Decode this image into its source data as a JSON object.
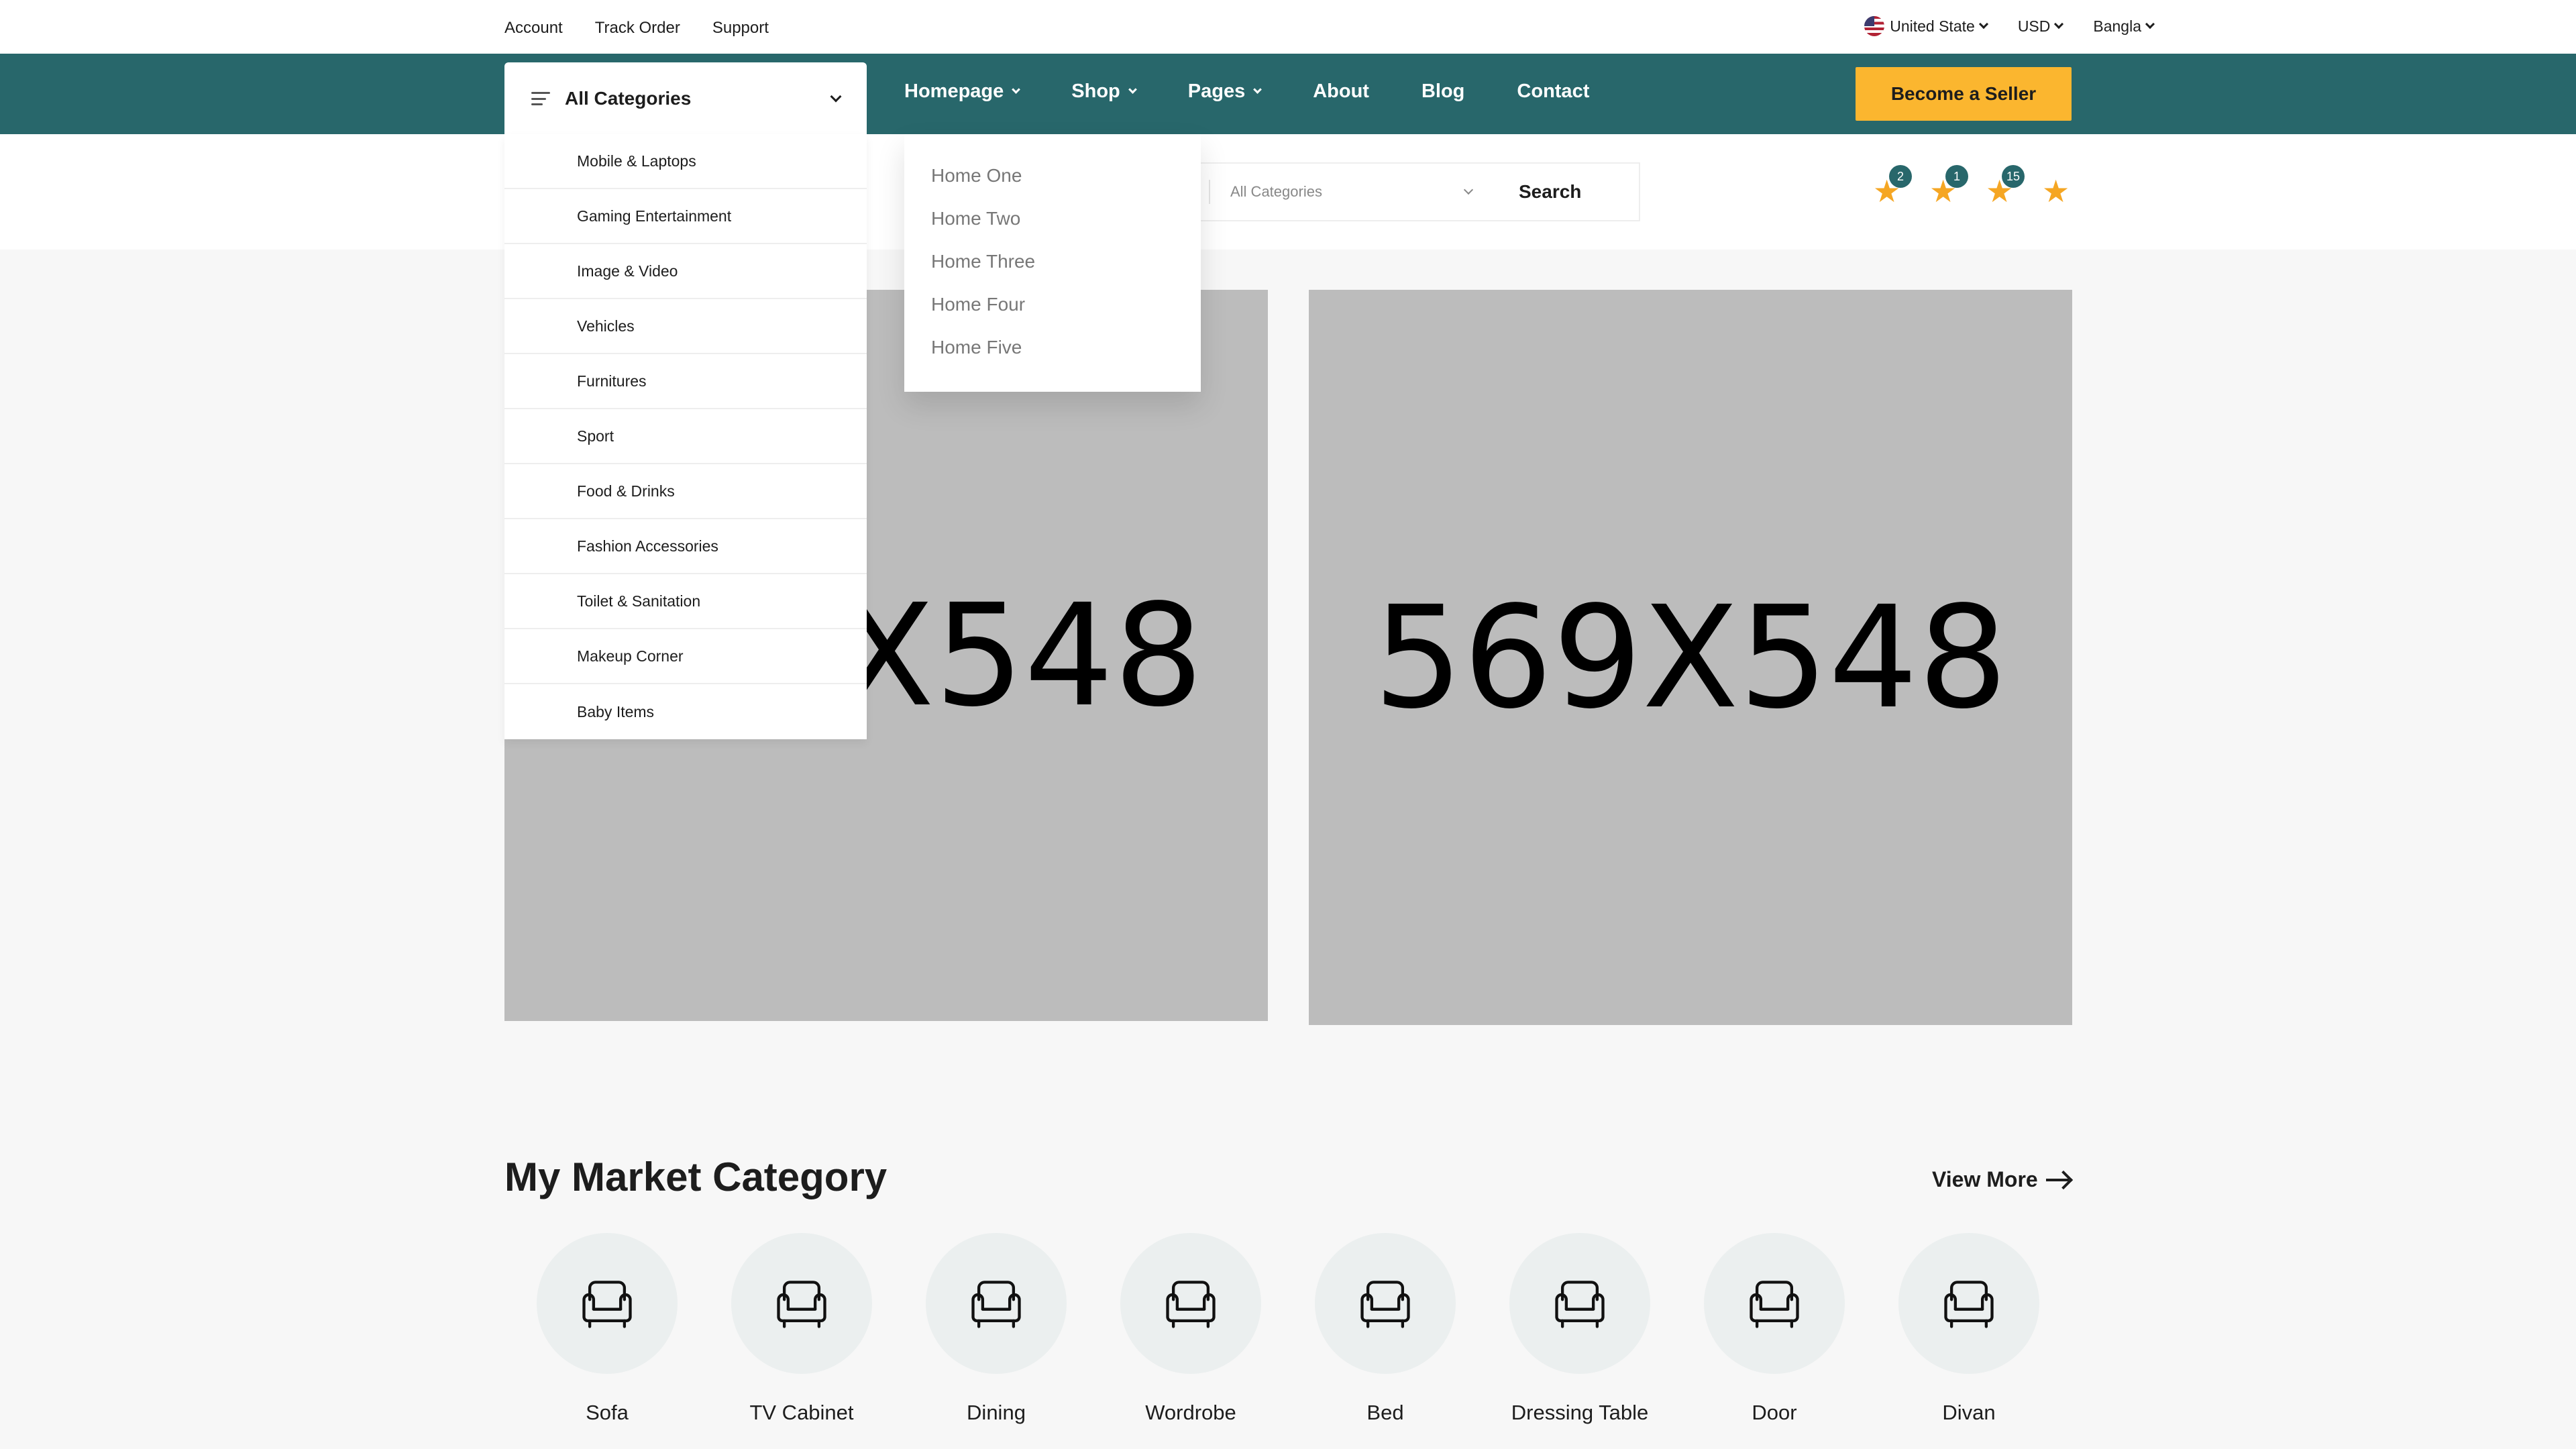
{
  "topbar": {
    "links": [
      "Account",
      "Track Order",
      "Support"
    ],
    "country": "United State",
    "currency": "USD",
    "language": "Bangla"
  },
  "nav": {
    "all_categories": "All Categories",
    "items": [
      "Homepage",
      "Shop",
      "Pages",
      "About",
      "Blog",
      "Contact"
    ],
    "seller_button": "Become a Seller"
  },
  "search": {
    "category": "All Categories",
    "button": "Search"
  },
  "header_icons": {
    "badges": [
      "2",
      "1",
      "15"
    ]
  },
  "categories_menu": [
    "Mobile & Laptops",
    "Gaming Entertainment",
    "Image & Video",
    "Vehicles",
    "Furnitures",
    "Sport",
    "Food & Drinks",
    "Fashion Accessories",
    "Toilet & Sanitation",
    "Makeup Corner",
    "Baby Items"
  ],
  "homepage_dropdown": [
    "Home One",
    "Home Two",
    "Home Three",
    "Home Four",
    "Home Five"
  ],
  "banners": {
    "left": "569X548",
    "right": "569X548"
  },
  "market": {
    "title": "My Market Category",
    "view_more": "View More",
    "items": [
      "Sofa",
      "TV Cabinet",
      "Dining",
      "Wordrobe",
      "Bed",
      "Dressing Table",
      "Door",
      "Divan"
    ]
  },
  "colors": {
    "nav_bg": "#28676b",
    "seller_bg": "#fbb62f",
    "star": "#f5a623"
  }
}
